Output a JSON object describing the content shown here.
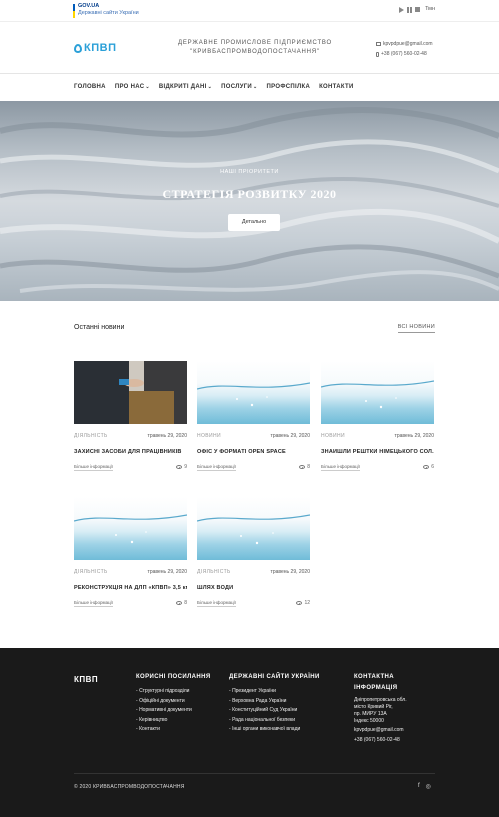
{
  "gov_bar": {
    "title": "GOV.UA",
    "subtitle": "Державні сайти України",
    "lang": "Тмн"
  },
  "header": {
    "logo_text": "КПВП",
    "company_line1": "ДЕРЖАВНЕ ПРОМИСЛОВЕ ПІДПРИЄМСТВО",
    "company_line2": "\"КРИВБАСПРОМВОДОПОСТАЧАННЯ\"",
    "email": "kpvpdpue@gmail.com",
    "phone": "+38 (067) 560-02-48"
  },
  "nav": {
    "items": [
      {
        "label": "ГОЛОВНА",
        "dropdown": false
      },
      {
        "label": "ПРО НАС",
        "dropdown": true
      },
      {
        "label": "ВІДКРИТІ ДАНІ",
        "dropdown": true
      },
      {
        "label": "ПОСЛУГИ",
        "dropdown": true
      },
      {
        "label": "ПРОФСПІЛКА",
        "dropdown": false
      },
      {
        "label": "КОНТАКТИ",
        "dropdown": false
      }
    ]
  },
  "hero": {
    "kicker": "НАШІ ПРІОРИТЕТИ",
    "title": "СТРАТЕГІЯ РОЗВИТКУ 2020",
    "button": "Детально"
  },
  "news": {
    "section_label": "Останні новини",
    "all_link": "ВСІ НОВИНИ",
    "cards": [
      {
        "image": "handshake-photo",
        "category": "ДІЯЛЬНІСТЬ",
        "date": "травень 29, 2020",
        "title": "ЗАХИСНІ ЗАСОБИ ДЛЯ ПРАЦІВНИКІВ",
        "more": "Більше інформації",
        "views": "9"
      },
      {
        "image": "water-splash",
        "category": "НОВИНИ",
        "date": "травень 29, 2020",
        "title": "ОФІС У ФОРМАТІ OPEN SPACE",
        "more": "Більше інформації",
        "views": "8"
      },
      {
        "image": "water-splash",
        "category": "НОВИНИ",
        "date": "травень 29, 2020",
        "title": "ЗНАЙШЛИ РЕШТКИ НІМЕЦЬКОГО СОЛ...",
        "more": "Більше інформації",
        "views": "6"
      },
      {
        "image": "water-splash",
        "category": "ДІЯЛЬНІСТЬ",
        "date": "травень 29, 2020",
        "title": "РЕКОНСТРУКЦІЯ НА ДЛП «КПВП» 3,5 км",
        "more": "Більше інформації",
        "views": "8"
      },
      {
        "image": "water-splash",
        "category": "ДІЯЛЬНІСТЬ",
        "date": "травень 29, 2020",
        "title": "ШЛЯХ ВОДИ",
        "more": "Більше інформації",
        "views": "12"
      }
    ]
  },
  "footer": {
    "logo_text": "КПВП",
    "useful_links": {
      "heading": "КОРИСНІ ПОСИЛАННЯ",
      "items": [
        "Структурні підрозділи",
        "Офіційні документи",
        "Нормативні документи",
        "Керівництво",
        "Контакти"
      ]
    },
    "gov_sites": {
      "heading": "ДЕРЖАВНІ САЙТИ УКРАЇНИ",
      "items": [
        "Президент України",
        "Верховна Рада України",
        "Конституційний Суд України",
        "Рада національної безпеки",
        "Інші органи виконавчої влади"
      ]
    },
    "contact": {
      "heading_line1": "КОНТАКТНА",
      "heading_line2": "ІНФОРМАЦІЯ",
      "address_line1": "Дніпропетровська обл.",
      "address_line2": "місто Кривий Ріг,",
      "address_line3": "пр. МИРУ 13А",
      "address_line4": "Індекс 50000",
      "email": "kpvpdpue@gmail.com",
      "phone": "+38 (067) 560-02-48"
    },
    "copyright": "© 2020 КРИВБАСПРОМВОДОПОСТАЧАННЯ",
    "social": [
      "facebook-icon",
      "instagram-icon"
    ]
  },
  "colors": {
    "brand_blue": "#2ba0d8",
    "footer_bg": "#1a1a1a",
    "ua_blue": "#005bbb",
    "ua_yellow": "#ffd500"
  }
}
